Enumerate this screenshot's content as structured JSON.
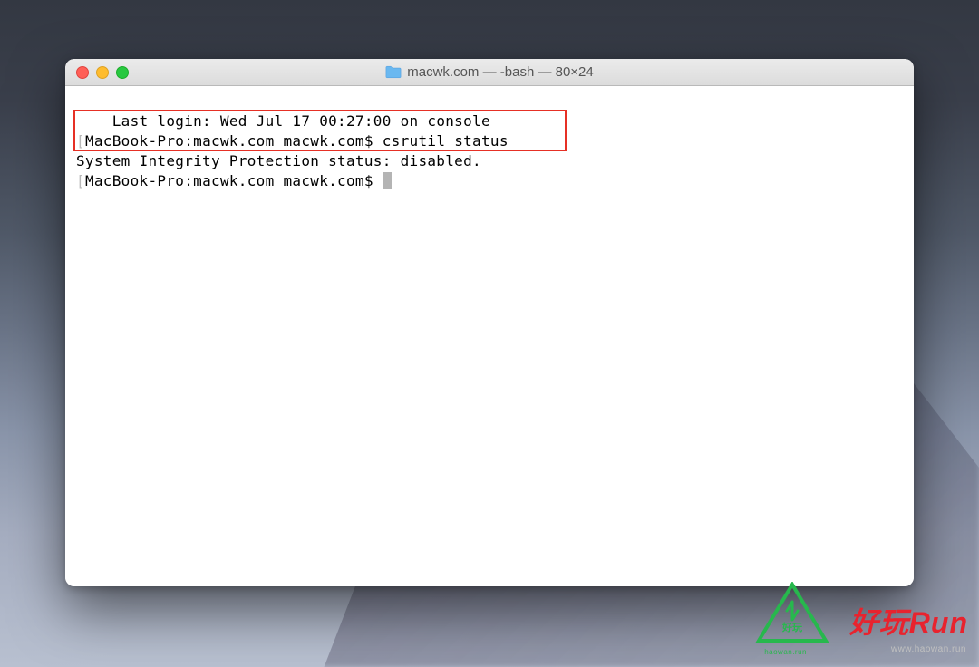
{
  "window": {
    "title": "macwk.com — -bash — 80×24"
  },
  "terminal": {
    "line1": "Last login: Wed Jul 17 00:27:00 on console",
    "line2_prefix": "[",
    "line2_prompt": "MacBook-Pro:macwk.com macwk.com$ ",
    "line2_command": "csrutil status",
    "line2_suffix": "]",
    "line3": "System Integrity Protection status: disabled.",
    "line4_prefix": "[",
    "line4_prompt": "MacBook-Pro:macwk.com macwk.com$ "
  },
  "watermark": {
    "logo_text": "好玩",
    "brand_text": "好玩Run",
    "sub_text": "www.haowan.run",
    "haowan_text": "haowan.run"
  }
}
